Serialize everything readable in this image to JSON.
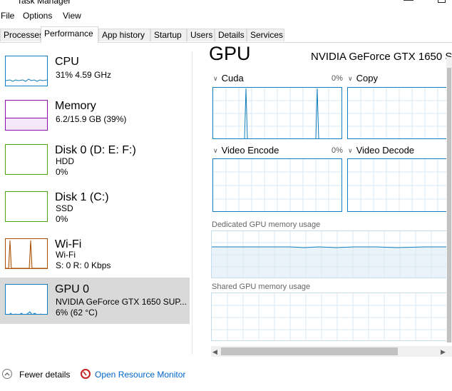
{
  "window": {
    "title": "Task Manager"
  },
  "menu": {
    "file": "File",
    "options": "Options",
    "view": "View"
  },
  "tabs": [
    {
      "label": "Processes",
      "active": false
    },
    {
      "label": "Performance",
      "active": true
    },
    {
      "label": "App history",
      "active": false
    },
    {
      "label": "Startup",
      "active": false
    },
    {
      "label": "Users",
      "active": false
    },
    {
      "label": "Details",
      "active": false
    },
    {
      "label": "Services",
      "active": false
    }
  ],
  "sidebar": {
    "cpu": {
      "title": "CPU",
      "line1": "31%  4.59 GHz",
      "color": "#117dbb"
    },
    "memory": {
      "title": "Memory",
      "line1": "6.2/15.9 GB (39%)",
      "color": "#8b12ae",
      "level": 0.39
    },
    "disk0": {
      "title": "Disk 0 (D: E: F:)",
      "line1": "HDD",
      "line2": "0%",
      "color": "#4da60c"
    },
    "disk1": {
      "title": "Disk 1 (C:)",
      "line1": "SSD",
      "line2": "0%",
      "color": "#4da60c"
    },
    "wifi": {
      "title": "Wi-Fi",
      "line1": "Wi-Fi",
      "line2": "S: 0  R: 0 Kbps",
      "color": "#a74f01"
    },
    "gpu0": {
      "title": "GPU 0",
      "line1": "NVIDIA GeForce GTX 1650 SUP...",
      "line2": "6%  (62 °C)",
      "color": "#117dbb"
    }
  },
  "main": {
    "heading": "GPU",
    "model": "NVIDIA GeForce GTX 1650 S",
    "engines": {
      "cuda": {
        "label": "Cuda",
        "pct": "0%"
      },
      "copy": {
        "label": "Copy"
      },
      "video_encode": {
        "label": "Video Encode",
        "pct": "0%"
      },
      "video_decode": {
        "label": "Video Decode"
      }
    },
    "dedicated_label": "Dedicated GPU memory usage",
    "shared_label": "Shared GPU memory usage"
  },
  "footer": {
    "fewer_details": "Fewer details",
    "open_resource_monitor": "Open Resource Monitor"
  },
  "colors": {
    "gpu_line": "#117dbb",
    "grid": "#d9eaf4",
    "selected_bg": "#d9d9d9"
  }
}
